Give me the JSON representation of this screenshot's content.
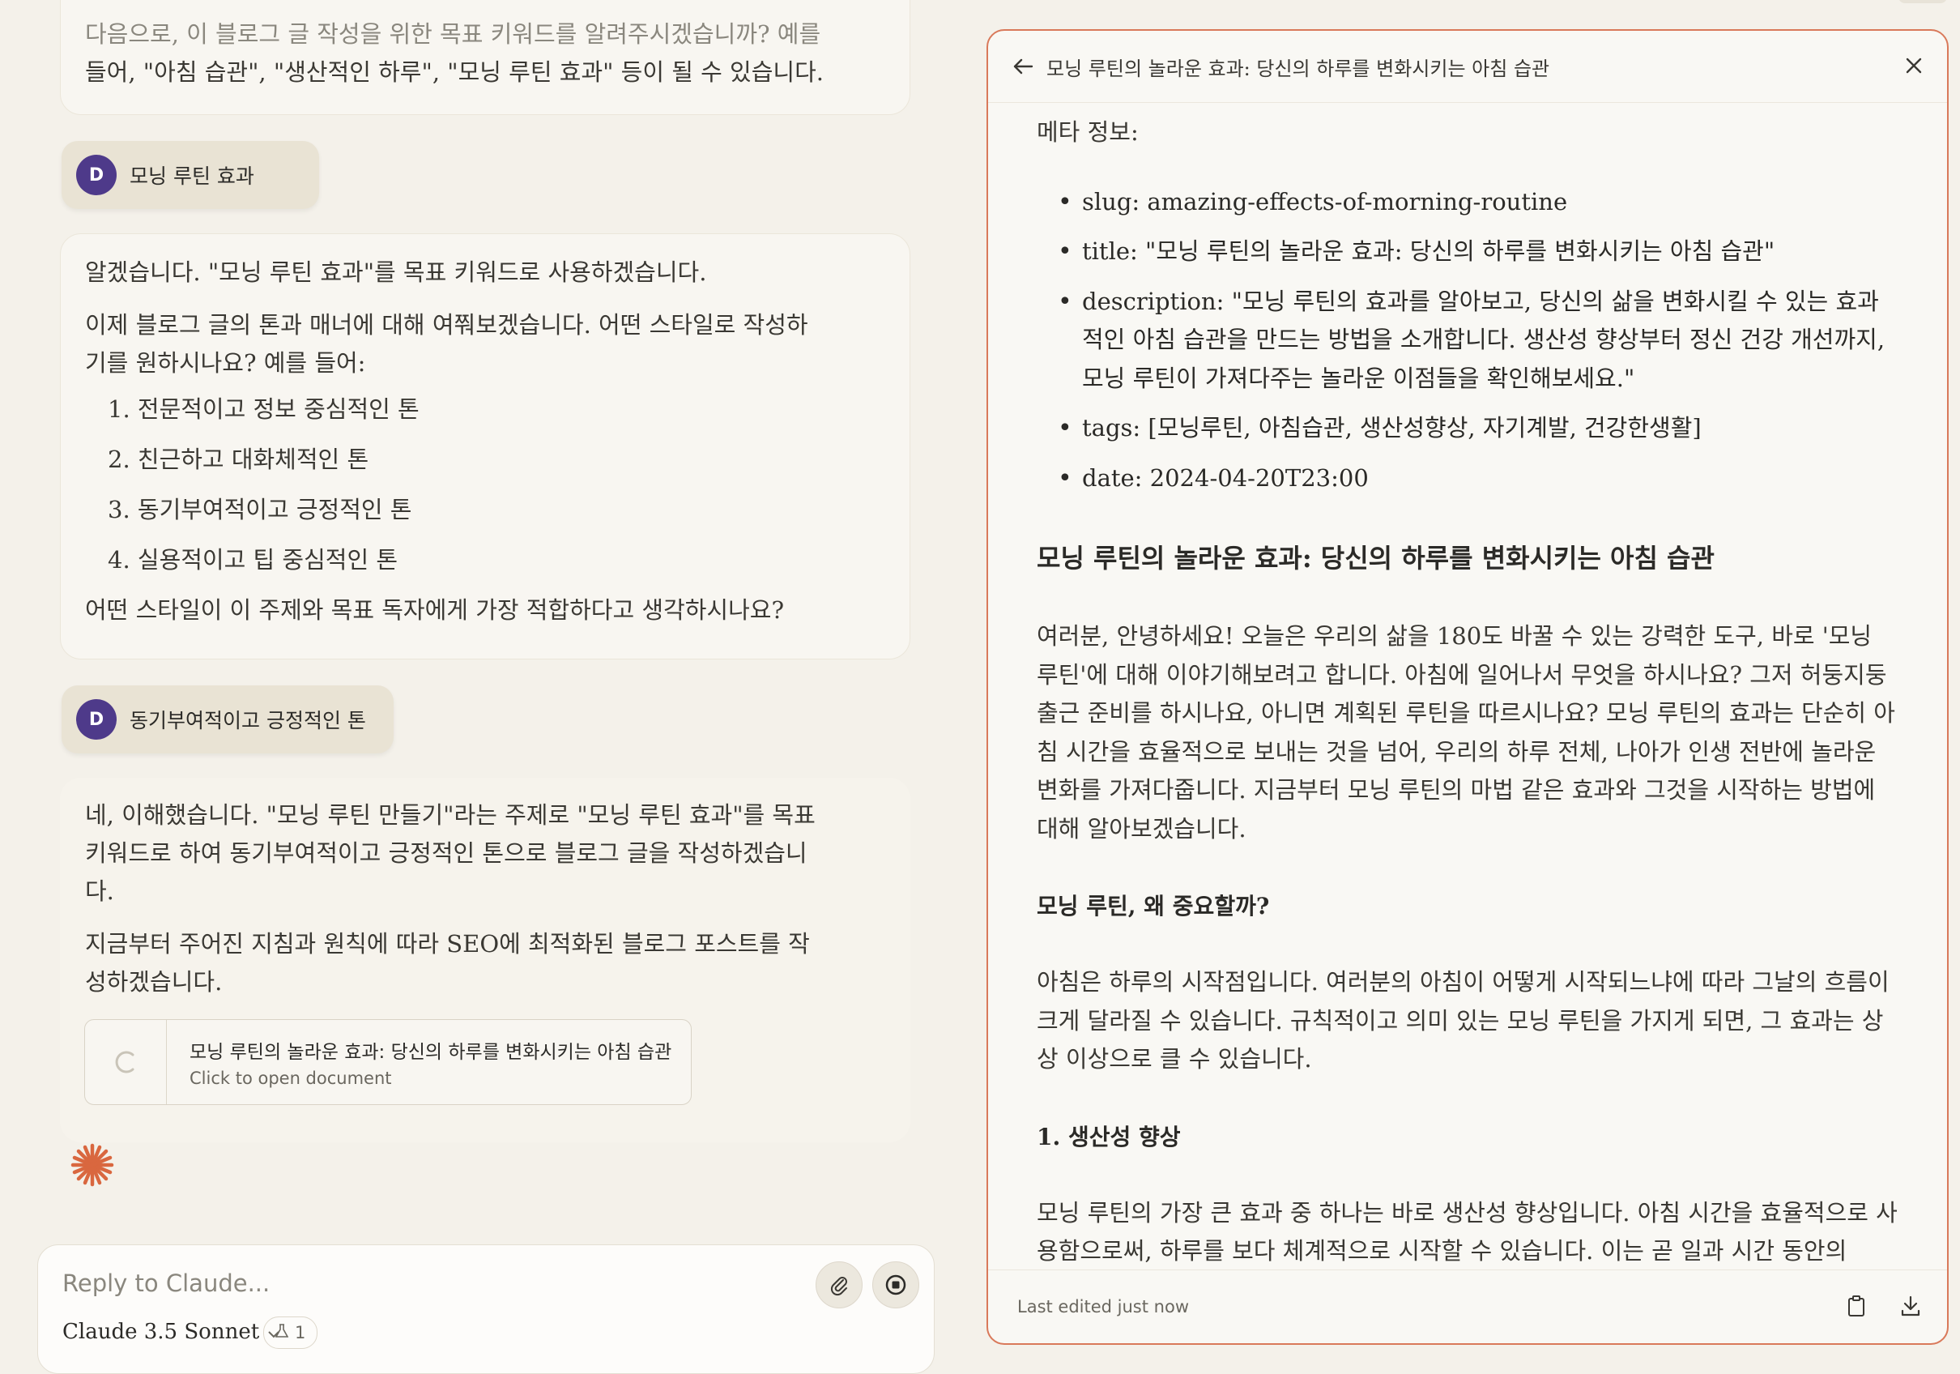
{
  "chat": {
    "messages": {
      "m1": {
        "lines": [
          "다음으로, 이 블로그 글 작성을 위한 목표 키워드를 알려주시겠습니까? 예를",
          "들어, \"아침 습관\", \"생산적인 하루\", \"모닝 루틴 효과\" 등이 될 수 있습니다."
        ]
      },
      "u1": {
        "avatar": "D",
        "text": "모닝 루틴 효과"
      },
      "m2": {
        "p1": "알겠습니다. \"모닝 루틴 효과\"를 목표 키워드로 사용하겠습니다.",
        "p2a": "이제 블로그 글의 톤과 매너에 대해 여쭤보겠습니다. 어떤 스타일로 작성하",
        "p2b": "기를 원하시나요? 예를 들어:",
        "options": [
          "1. 전문적이고 정보 중심적인 톤",
          "2. 친근하고 대화체적인 톤",
          "3. 동기부여적이고 긍정적인 톤",
          "4. 실용적이고 팁 중심적인 톤"
        ],
        "p3": "어떤 스타일이 이 주제와 목표 독자에게 가장 적합하다고 생각하시나요?"
      },
      "u2": {
        "avatar": "D",
        "text": "동기부여적이고 긍정적인 톤"
      },
      "m3": {
        "p1": [
          "네, 이해했습니다. \"모닝 루틴 만들기\"라는 주제로 \"모닝 루틴 효과\"를 목표",
          "키워드로 하여 동기부여적이고 긍정적인 톤으로 블로그 글을 작성하겠습니",
          "다."
        ],
        "p2": [
          "지금부터 주어진 지침과 원칙에 따라 SEO에 최적화된 블로그 포스트를 작",
          "성하겠습니다."
        ]
      }
    },
    "doc_card": {
      "title": "모닝 루틴의 놀라운 효과: 당신의 하루를 변화시키는 아침 습관",
      "subtitle": "Click to open document"
    },
    "input": {
      "placeholder": "Reply to Claude...",
      "model": "Claude 3.5 Sonnet",
      "attachments_count": "1"
    },
    "colors": {
      "avatar": "#4e3a8a",
      "spark": "#d9673f"
    }
  },
  "artifact": {
    "title": "모닝 루틴의 놀라운 효과: 당신의 하루를 변화시키는 아침 습관",
    "meta_heading": "메타 정보:",
    "meta": [
      "slug: amazing-effects-of-morning-routine",
      "title: \"모닝 루틴의 놀라운 효과: 당신의 하루를 변화시키는 아침 습관\"",
      "description: \"모닝 루틴의 효과를 알아보고, 당신의 삶을 변화시킬 수 있는 효과적인 아침 습관을 만드는 방법을 소개합니다. 생산성 향상부터 정신 건강 개선까지, 모닝 루틴이 가져다주는 놀라운 이점들을 확인해보세요.\"",
      "tags: [모닝루틴, 아침습관, 생산성향상, 자기계발, 건강한생활]",
      "date: 2024-04-20T23:00"
    ],
    "heading": "모닝 루틴의 놀라운 효과: 당신의 하루를 변화시키는 아침 습관",
    "intro": "여러분, 안녕하세요! 오늘은 우리의 삶을 180도 바꿀 수 있는 강력한 도구, 바로 '모닝 루틴'에 대해 이야기해보려고 합니다. 아침에 일어나서 무엇을 하시나요? 그저 허둥지둥 출근 준비를 하시나요, 아니면 계획된 루틴을 따르시나요? 모닝 루틴의 효과는 단순히 아침 시간을 효율적으로 보내는 것을 넘어, 우리의 하루 전체, 나아가 인생 전반에 놀라운 변화를 가져다줍니다. 지금부터 모닝 루틴의 마법 같은 효과와 그것을 시작하는 방법에 대해 알아보겠습니다.",
    "section1_title": "모닝 루틴, 왜 중요할까?",
    "section1_body": "아침은 하루의 시작점입니다. 여러분의 아침이 어떻게 시작되느냐에 따라 그날의 흐름이 크게 달라질 수 있습니다. 규칙적이고 의미 있는 모닝 루틴을 가지게 되면, 그 효과는 상상 이상으로 클 수 있습니다.",
    "section2_title": "1. 생산성 향상",
    "section2_body": "모닝 루틴의 가장 큰 효과 중 하나는 바로 생산성 향상입니다. 아침 시간을 효율적으로 사용함으로써, 하루를 보다 체계적으로 시작할 수 있습니다. 이는 곧 일과 시간 동안의",
    "footer": "Last edited just now",
    "accent": "#d9795a"
  }
}
